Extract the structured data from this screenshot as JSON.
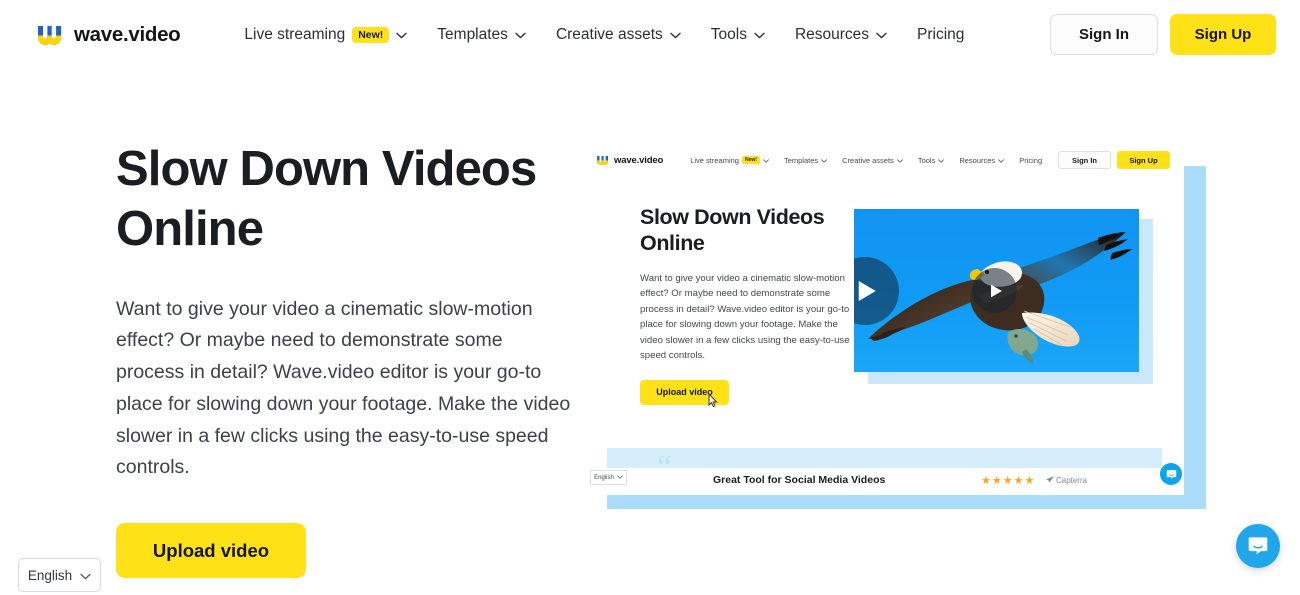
{
  "brand": {
    "name": "wave.video",
    "accent_yellow": "#ffe117",
    "accent_blue": "#0d9df0",
    "accent_light_blue": "#a9ddf9",
    "text_dark": "#1a1d21"
  },
  "navbar": {
    "logo_text": "wave.video",
    "logo_icon": "wave-w-logo-icon",
    "items": [
      {
        "label": "Live streaming",
        "badge": "New!",
        "has_chevron": true
      },
      {
        "label": "Templates",
        "badge": "",
        "has_chevron": true
      },
      {
        "label": "Creative assets",
        "badge": "",
        "has_chevron": true
      },
      {
        "label": "Tools",
        "badge": "",
        "has_chevron": true
      },
      {
        "label": "Resources",
        "badge": "",
        "has_chevron": true
      },
      {
        "label": "Pricing",
        "badge": "",
        "has_chevron": false
      }
    ],
    "sign_in": "Sign In",
    "sign_up": "Sign Up"
  },
  "hero": {
    "title": "Slow Down Videos Online",
    "paragraph": "Want to give your video a cinematic slow-motion effect? Or maybe need to demonstrate some process in detail? Wave.video editor is your go-to place for slowing down your footage. Make the video slower in a few clicks using the easy-to-use speed controls.",
    "cta": "Upload video"
  },
  "language_selector": {
    "value": "English",
    "icon": "chevron-down-icon"
  },
  "preview": {
    "navbar": {
      "logo_text": "wave.video",
      "items": [
        {
          "label": "Live streaming",
          "badge": "New!",
          "has_chevron": true
        },
        {
          "label": "Templates",
          "badge": "",
          "has_chevron": true
        },
        {
          "label": "Creative assets",
          "badge": "",
          "has_chevron": true
        },
        {
          "label": "Tools",
          "badge": "",
          "has_chevron": true
        },
        {
          "label": "Resources",
          "badge": "",
          "has_chevron": true
        },
        {
          "label": "Pricing",
          "badge": "",
          "has_chevron": false
        }
      ],
      "sign_in": "Sign In",
      "sign_up": "Sign Up"
    },
    "hero": {
      "title": "Slow Down Videos Online",
      "paragraph": "Want to give your video a cinematic slow-motion effect? Or maybe need to demonstrate some process in detail? Wave.video editor is your go-to place for slowing down your footage. Make the video slower in a few clicks using the easy-to-use speed controls.",
      "cta": "Upload video"
    },
    "video": {
      "image_alt": "bald-eagle-flying-with-fish-against-blue-sky",
      "play_button_icon": "play-icon",
      "play_button_count": 2
    },
    "testimonial": {
      "quote_mark": "“",
      "text": "Great Tool for Social Media Videos",
      "stars": "★★★★★",
      "rating": 5,
      "source": "Capterra"
    },
    "language_selector": {
      "value": "English"
    },
    "chat_icon": "intercom-chat-icon"
  },
  "chat_widget": {
    "icon": "intercom-chat-icon",
    "color": "#1fa7ea"
  }
}
